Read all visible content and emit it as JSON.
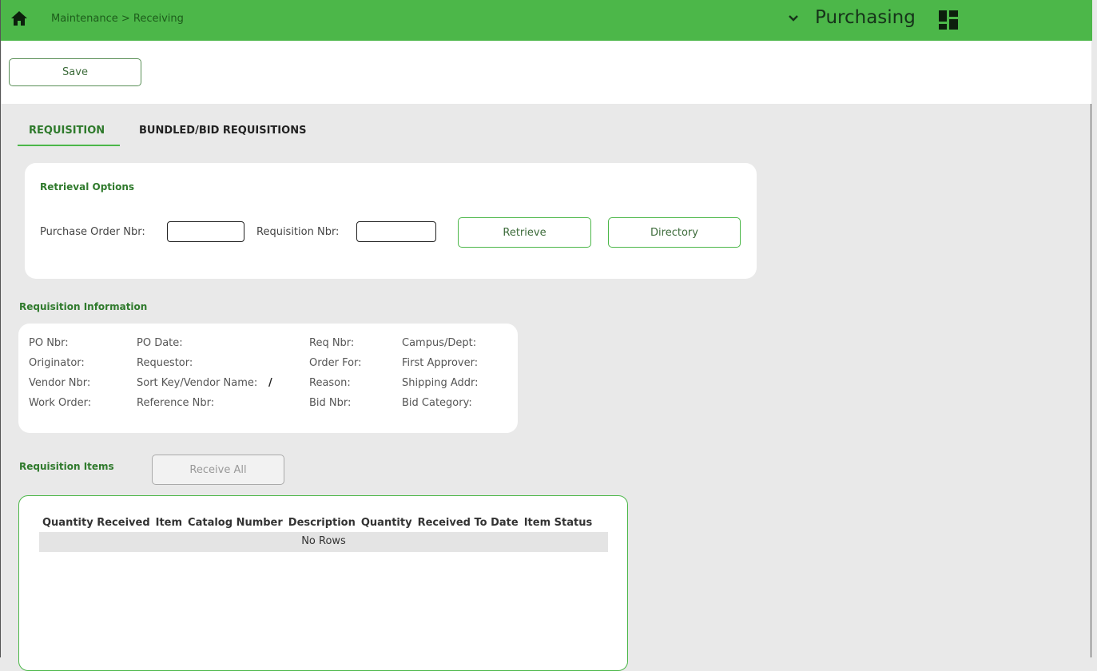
{
  "topbar": {
    "breadcrumb": "Maintenance > Receiving",
    "app_title": "Purchasing"
  },
  "toolbar": {
    "save_label": "Save"
  },
  "tabs": [
    {
      "label": "REQUISITION",
      "active": true
    },
    {
      "label": "BUNDLED/BID REQUISITIONS",
      "active": false
    }
  ],
  "retrieval": {
    "title": "Retrieval Options",
    "po_label": "Purchase Order Nbr:",
    "po_value": "",
    "req_label": "Requisition Nbr:",
    "req_value": "",
    "retrieve_label": "Retrieve",
    "directory_label": "Directory"
  },
  "requisition_info": {
    "title": "Requisition Information",
    "rows": [
      [
        "PO Nbr:",
        "PO Date:",
        "Req Nbr:",
        "Campus/Dept:"
      ],
      [
        "Originator:",
        "Requestor:",
        "Order For:",
        "First Approver:"
      ],
      [
        "Vendor Nbr:",
        "Sort Key/Vendor Name:",
        "Reason:",
        "Shipping Addr:"
      ],
      [
        "Work Order:",
        "Reference Nbr:",
        "Bid Nbr:",
        "Bid Category:"
      ]
    ],
    "vendor_separator": "/"
  },
  "items": {
    "title": "Requisition Items",
    "receive_all_label": "Receive All",
    "columns": [
      "Quantity Received",
      "Item",
      "Catalog Number",
      "Description",
      "Quantity",
      "Received To Date",
      "Item Status"
    ],
    "empty_text": "No Rows"
  },
  "colors": {
    "brand_green": "#4cb749",
    "label_green": "#2f7a2c"
  }
}
